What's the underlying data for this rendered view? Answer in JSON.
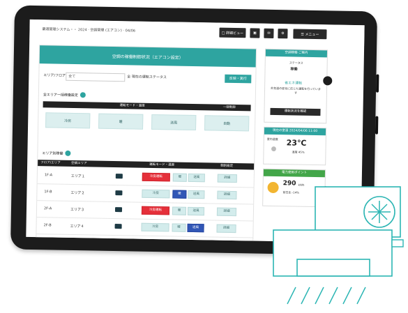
{
  "topbar": {
    "crumb": "最適管理システム・・ 2024 · 空調管理 (エアコン) · 04/06",
    "btn_main": "□ 詳細ビュー",
    "btn_menu": "☰ メニュー"
  },
  "main": {
    "title": "空調の稼働制御状況（エアコン設定）",
    "filter_label": "エリア/フロア",
    "filter_value": "全て",
    "filter_mid": "全 現在の運転ステータス",
    "run_button": "反映・実行",
    "section1_title": "全エリア一括稼働設定",
    "section1_bar_mid": "運転モード・温度",
    "section1_bar_right": "一括制御",
    "tiles": [
      "冷房",
      "暖",
      "送風",
      "自動"
    ],
    "section2_title": "エリア別稼働",
    "table_headers": [
      "フロア/エリア",
      "空調エリア",
      "運転モード・温度",
      "個別設定"
    ],
    "rows": [
      {
        "floor": "1F-A",
        "area": "エリア１",
        "mode": "冷房運転",
        "opt1": "暖",
        "opt2": "送風",
        "set": "詳細"
      },
      {
        "floor": "1F-B",
        "area": "エリア２",
        "mode": "冷房",
        "opt1": "暖",
        "opt2": "送風",
        "set": "詳細"
      },
      {
        "floor": "2F-A",
        "area": "エリア３",
        "mode": "冷房運転",
        "opt1": "暖",
        "opt2": "送風",
        "set": "詳細"
      },
      {
        "floor": "2F-B",
        "area": "エリア４",
        "mode": "冷房",
        "opt1": "暖",
        "opt2": "送風",
        "set": "詳細"
      }
    ]
  },
  "side": {
    "card1_title": "空調稼働 ご案内",
    "card1_label": "ステータス",
    "card1_status": "稼働",
    "card1_link": "省エネ運転",
    "card1_note": "外気温の変化に応じた運転を行っています",
    "card1_button": "運転状況を確認",
    "card2_title": "現在の室温 2024/04/06 11:00",
    "card2_label": "室内温度",
    "card2_temp": "23℃",
    "card2_sub": "湿度 45%",
    "card3_title": "電力使用ポイント",
    "card3_value": "290",
    "card3_unit": "kWh",
    "card3_sub": "前日比 -14%"
  },
  "colors": {
    "accent": "#2ea4a0",
    "danger": "#e5303a",
    "active": "#3156b6",
    "line_art": "#2bb5b3"
  }
}
